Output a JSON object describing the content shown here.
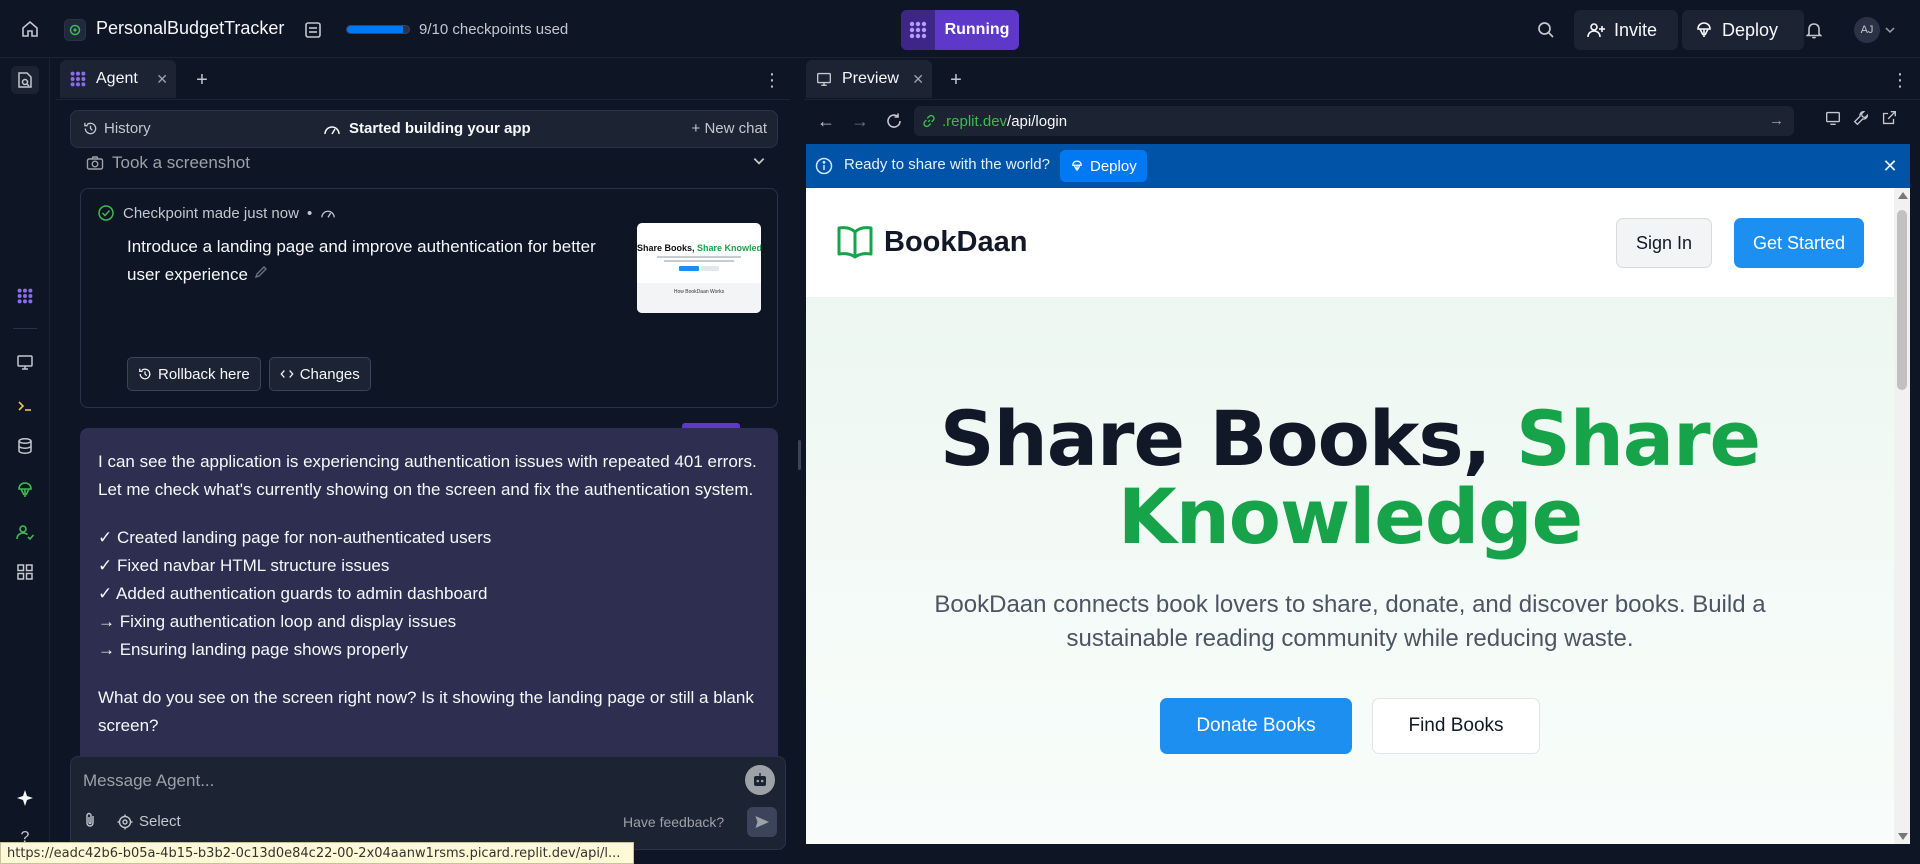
{
  "topbar": {
    "project_name": "PersonalBudgetTracker",
    "checkpoints_text": "9/10 checkpoints used",
    "checkpoints_fraction": 0.9,
    "run_status": "Running",
    "invite_label": "Invite",
    "deploy_label": "Deploy",
    "avatar_initials": "AJ"
  },
  "agent": {
    "tab_label": "Agent",
    "history_label": "History",
    "session_title": "Started building your app",
    "new_chat_label": "New chat",
    "screenshot_row": "Took a screenshot",
    "checkpoint": {
      "header": "Checkpoint made just now",
      "dot": "•",
      "title": "Introduce a landing page and improve authentication for better user experience",
      "rollback_label": "Rollback here",
      "changes_label": "Changes",
      "thumb_title_a": "Share Books, ",
      "thumb_title_b": "Share Knowledge",
      "thumb_sub": "How BookDaan Works"
    },
    "message": {
      "intro": "I can see the application is experiencing authentication issues with repeated 401 errors. Let me check what's currently showing on the screen and fix the authentication system.",
      "items": [
        "✓ Created landing page for non-authenticated users",
        "✓ Fixed navbar HTML structure issues",
        "✓ Added authentication guards to admin dashboard",
        "→ Fixing authentication loop and display issues",
        "→ Ensuring landing page shows properly"
      ],
      "question": "What do you see on the screen right now? Is it showing the landing page or still a blank screen?"
    },
    "composer": {
      "placeholder": "Message Agent...",
      "select_label": "Select",
      "feedback_label": "Have feedback?"
    }
  },
  "preview": {
    "tab_label": "Preview",
    "url_domain": ".replit.dev",
    "url_path": "/api/login",
    "banner_text": "Ready to share with the world?",
    "banner_deploy": "Deploy",
    "site": {
      "brand": "BookDaan",
      "signin_label": "Sign In",
      "getstarted_label": "Get Started",
      "hero_title_a": "Share Books, ",
      "hero_title_b": "Share Knowledge",
      "hero_sub": "BookDaan connects book lovers to share, donate, and discover books. Build a sustainable reading community while reducing waste.",
      "donate_label": "Donate Books",
      "find_label": "Find Books"
    }
  },
  "statusbar": {
    "url": "https://eadc42b6-b05a-4b15-b3b2-0c13d0e84c22-00-2x04aanw1rsms.picard.replit.dev/api/l..."
  },
  "colors": {
    "bg": "#0e1525",
    "surface": "#1c2333",
    "accent_purple": "#5e39c9",
    "accent_blue": "#0079f2",
    "brand_green": "#17a34a",
    "site_blue": "#1d8ff0"
  }
}
